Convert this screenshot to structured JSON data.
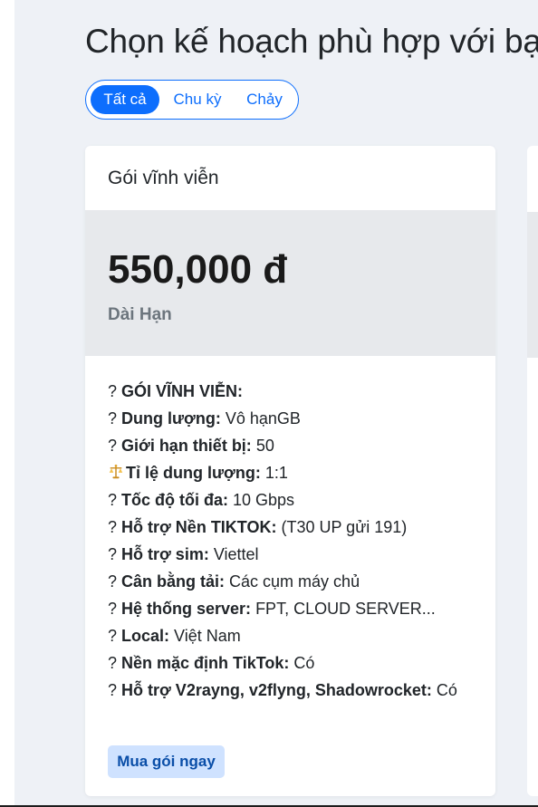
{
  "header": {
    "title": "Chọn kế hoạch phù hợp với bạn"
  },
  "filters": {
    "items": [
      {
        "label": "Tất cả",
        "active": true
      },
      {
        "label": "Chu kỳ",
        "active": false
      },
      {
        "label": "Chảy",
        "active": false
      }
    ]
  },
  "plan": {
    "title": "Gói vĩnh viễn",
    "price": "550,000 đ",
    "price_note": "Dài Hạn",
    "features": [
      {
        "prefix": "? ",
        "label": "GÓI VĨNH VIỄN:",
        "value": ""
      },
      {
        "prefix": "? ",
        "label": "Dung lượng:",
        "value": " Vô hạnGB"
      },
      {
        "prefix": "? ",
        "label": "Giới hạn thiết bị:",
        "value": " 50"
      },
      {
        "prefix": "",
        "label": "Tỉ lệ dung lượng:",
        "value": " 1:1",
        "icon": "balance-scale-icon"
      },
      {
        "prefix": "? ",
        "label": "Tốc độ tối đa:",
        "value": " 10 Gbps"
      },
      {
        "prefix": "? ",
        "label": "Hỗ trợ Nền TIKTOK:",
        "value": " (T30 UP gửi 191)"
      },
      {
        "prefix": "? ",
        "label": "Hỗ trợ sim:",
        "value": " Viettel"
      },
      {
        "prefix": "? ",
        "label": "Cân bằng tải:",
        "value": " Các cụm máy chủ"
      },
      {
        "prefix": "? ",
        "label": "Hệ thống server:",
        "value": " FPT, CLOUD SERVER..."
      },
      {
        "prefix": "? ",
        "label": "Local:",
        "value": " Việt Nam"
      },
      {
        "prefix": "? ",
        "label": "Nền mặc định TikTok:",
        "value": " Có"
      },
      {
        "prefix": "? ",
        "label": "Hỗ trợ V2rayng, v2flyng, Shadowrocket:",
        "value": " Có"
      }
    ],
    "buy_label": "Mua gói ngay"
  },
  "colors": {
    "accent": "#0d6efd",
    "page_background": "#eef1f6",
    "price_band": "#e7e9ec",
    "buy_button_bg": "#cfe2ff",
    "buy_button_text": "#0a4ea8"
  }
}
